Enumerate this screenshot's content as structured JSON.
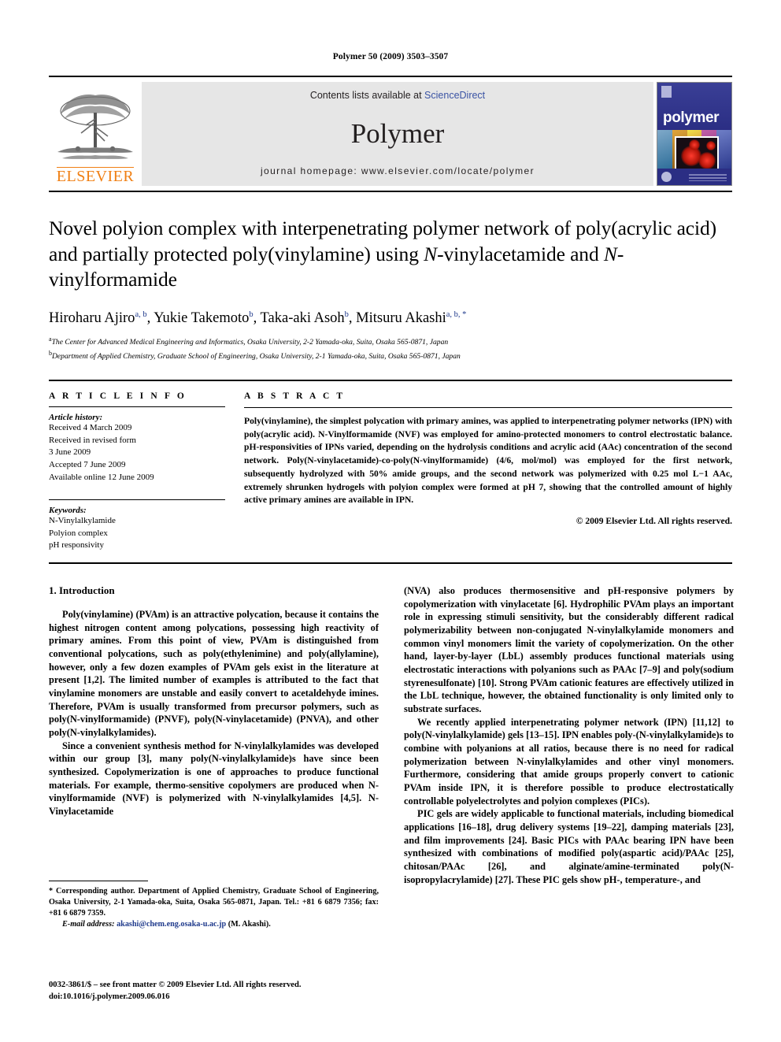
{
  "running_head": "Polymer 50 (2009) 3503–3507",
  "masthead": {
    "contents_prefix": "Contents lists available at ",
    "sciencedirect": "ScienceDirect",
    "journal_name": "Polymer",
    "homepage": "journal homepage: www.elsevier.com/locate/polymer",
    "publisher_wordmark": "ELSEVIER",
    "cover_title": "polymer",
    "accent_blue": "#3a53a4",
    "elsevier_orange": "#F07F13",
    "cover_blue": "#2b2e84"
  },
  "article": {
    "title_line1": "Novel polyion complex with interpenetrating polymer network of poly(acrylic",
    "title_line2_a": "acid) and partially protected poly(vinylamine) using ",
    "title_line2_italic": "N",
    "title_line2_b": "-vinylacetamide and",
    "title_line3_italic": "N",
    "title_line3_b": "-vinylformamide",
    "authors": "Hiroharu Ajiro, Yukie Takemoto, Taka-aki Asoh, Mitsuru Akashi",
    "author_list": [
      {
        "name": "Hiroharu Ajiro",
        "marks": "a, b"
      },
      {
        "name": "Yukie Takemoto",
        "marks": "b"
      },
      {
        "name": "Taka-aki Asoh",
        "marks": "b"
      },
      {
        "name": "Mitsuru Akashi",
        "marks": "a, b, *"
      }
    ],
    "affiliations": [
      {
        "mark": "a",
        "text": "The Center for Advanced Medical Engineering and Informatics, Osaka University, 2-2 Yamada-oka, Suita, Osaka 565-0871, Japan"
      },
      {
        "mark": "b",
        "text": "Department of Applied Chemistry, Graduate School of Engineering, Osaka University, 2-1 Yamada-oka, Suita, Osaka 565-0871, Japan"
      }
    ]
  },
  "article_info": {
    "label": "A R T I C L E  I N F O",
    "history_heading": "Article history:",
    "history": [
      "Received 4 March 2009",
      "Received in revised form",
      "3 June 2009",
      "Accepted 7 June 2009",
      "Available online 12 June 2009"
    ],
    "keywords_heading": "Keywords:",
    "keywords": [
      "N-Vinylalkylamide",
      "Polyion complex",
      "pH responsivity"
    ]
  },
  "abstract": {
    "label": "A B S T R A C T",
    "text": "Poly(vinylamine), the simplest polycation with primary amines, was applied to interpenetrating polymer networks (IPN) with poly(acrylic acid). N-Vinylformamide (NVF) was employed for amino-protected monomers to control electrostatic balance. pH-responsivities of IPNs varied, depending on the hydrolysis conditions and acrylic acid (AAc) concentration of the second network. Poly(N-vinylacetamide)-co-poly(N-vinylformamide) (4/6, mol/mol) was employed for the first network, subsequently hydrolyzed with 50% amide groups, and the second network was polymerized with 0.25 mol L−1 AAc, extremely shrunken hydrogels with polyion complex were formed at pH 7, showing that the controlled amount of highly active primary amines are available in IPN.",
    "copyright": "© 2009 Elsevier Ltd. All rights reserved."
  },
  "body": {
    "section_number": "1.",
    "section_title": "Introduction",
    "left_paragraphs": [
      "Poly(vinylamine) (PVAm) is an attractive polycation, because it contains the highest nitrogen content among polycations, possessing high reactivity of primary amines. From this point of view, PVAm is distinguished from conventional polycations, such as poly(ethylenimine) and poly(allylamine), however, only a few dozen examples of PVAm gels exist in the literature at present [1,2]. The limited number of examples is attributed to the fact that vinylamine monomers are unstable and easily convert to acetaldehyde imines. Therefore, PVAm is usually transformed from precursor polymers, such as poly(N-vinylformamide) (PNVF), poly(N-vinylacetamide) (PNVA), and other poly(N-vinylalkylamides).",
      "Since a convenient synthesis method for N-vinylalkylamides was developed within our group [3], many poly(N-vinylalkylamide)s have since been synthesized. Copolymerization is one of approaches to produce functional materials. For example, thermo-sensitive copolymers are produced when N-vinylformamide (NVF) is polymerized with N-vinylalkylamides [4,5]. N-Vinylacetamide"
    ],
    "right_paragraphs": [
      "(NVA) also produces thermosensitive and pH-responsive polymers by copolymerization with vinylacetate [6]. Hydrophilic PVAm plays an important role in expressing stimuli sensitivity, but the considerably different radical polymerizability between non-conjugated N-vinylalkylamide monomers and common vinyl monomers limit the variety of copolymerization. On the other hand, layer-by-layer (LbL) assembly produces functional materials using electrostatic interactions with polyanions such as PAAc [7–9] and poly(sodium styrenesulfonate) [10]. Strong PVAm cationic features are effectively utilized in the LbL technique, however, the obtained functionality is only limited only to substrate surfaces.",
      "We recently applied interpenetrating polymer network (IPN) [11,12] to poly(N-vinylalkylamide) gels [13–15]. IPN enables poly-(N-vinylalkylamide)s to combine with polyanions at all ratios, because there is no need for radical polymerization between N-vinylalkylamides and other vinyl monomers. Furthermore, considering that amide groups properly convert to cationic PVAm inside IPN, it is therefore possible to produce electrostatically controllable polyelectrolytes and polyion complexes (PICs).",
      "PIC gels are widely applicable to functional materials, including biomedical applications [16–18], drug delivery systems [19–22], damping materials [23], and film improvements [24]. Basic PICs with PAAc bearing IPN have been synthesized with combinations of modified poly(aspartic acid)/PAAc [25], chitosan/PAAc [26], and alginate/amine-terminated poly(N-isopropylacrylamide) [27]. These PIC gels show pH-, temperature-, and"
    ]
  },
  "footnotes": {
    "corresponding": "* Corresponding author. Department of Applied Chemistry, Graduate School of Engineering, Osaka University, 2-1 Yamada-oka, Suita, Osaka 565-0871, Japan. Tel.: +81 6 6879 7356; fax: +81 6 6879 7359.",
    "email_label": "E-mail address:",
    "email": "akashi@chem.eng.osaka-u.ac.jp",
    "email_suffix": " (M. Akashi)."
  },
  "colophon": {
    "line1": "0032-3861/$ – see front matter © 2009 Elsevier Ltd. All rights reserved.",
    "line2": "doi:10.1016/j.polymer.2009.06.016"
  }
}
